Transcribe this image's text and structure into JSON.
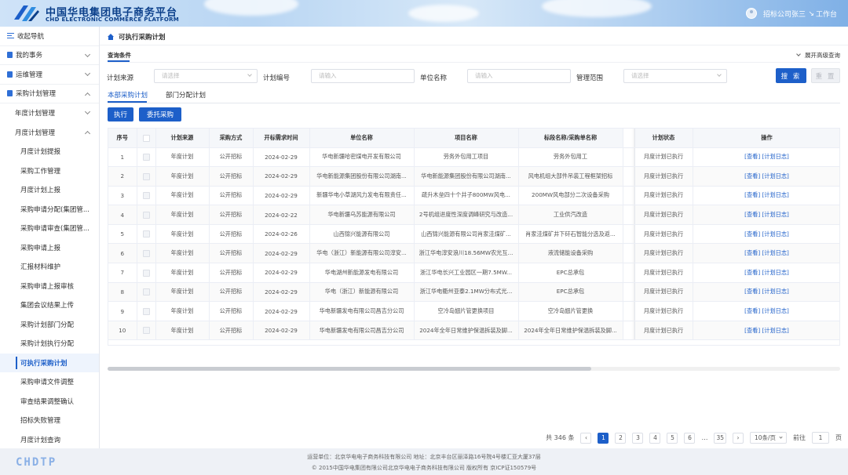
{
  "header": {
    "brand_cn": "中国华电集团电子商务平台",
    "brand_en": "CHD ELECTRONIC COMMERCE PLATFORM",
    "user_name": "招标公司张三",
    "workbench_label": "工作台"
  },
  "sidebar": {
    "collapse_label": "收起导航",
    "sections": [
      {
        "label": "我的事务",
        "expanded": false
      },
      {
        "label": "运维管理",
        "expanded": false
      },
      {
        "label": "采购计划管理",
        "expanded": true
      }
    ],
    "sub_groups": [
      {
        "label": "年度计划管理",
        "expanded": false
      },
      {
        "label": "月度计划管理",
        "expanded": true
      }
    ],
    "items": [
      "月度计划提报",
      "采购工作管理",
      "月度计划上报",
      "采购申请分配(集团管...",
      "采购申请审查(集团管...",
      "采购申请上报",
      "汇报材料维护",
      "采购申请上报审核",
      "集团会议结果上传",
      "采购计划部门分配",
      "采购计划执行分配",
      "可执行采购计划",
      "采购申请文件调整",
      "审查结果调整确认",
      "招标失败管理",
      "月度计划查询"
    ],
    "active_item": "可执行采购计划"
  },
  "breadcrumb": {
    "title": "可执行采购计划"
  },
  "query": {
    "title": "查询条件",
    "advanced_label": "展开高级查询",
    "fields": [
      {
        "label": "计划来源",
        "placeholder": "请选择",
        "type": "select"
      },
      {
        "label": "计划编号",
        "placeholder": "请输入",
        "type": "input"
      },
      {
        "label": "单位名称",
        "placeholder": "请输入",
        "type": "input"
      },
      {
        "label": "管理范围",
        "placeholder": "请选择",
        "type": "select"
      }
    ],
    "search_label": "搜 索",
    "reset_label": "重 置"
  },
  "tabs": [
    {
      "label": "本部采购计划",
      "active": true
    },
    {
      "label": "部门分配计划",
      "active": false
    }
  ],
  "actions": {
    "execute_label": "执行",
    "entrust_label": "委托采购"
  },
  "table": {
    "columns": [
      "序号",
      "",
      "计划来源",
      "采购方式",
      "开标需求时间",
      "单位名称",
      "项目名称",
      "标段名称/采购单名称",
      "",
      "计划状态",
      "操作"
    ],
    "action_view": "[查看]",
    "action_log": "[计划日志]",
    "rows": [
      {
        "no": "1",
        "source": "年度计划",
        "method": "公开招标",
        "date": "2024-02-29",
        "unit": "华电新疆哈密煤电开发有限公司",
        "project": "劳务外包用工项目",
        "section": "劳务外包用工",
        "status": "月度计划已执行"
      },
      {
        "no": "2",
        "source": "年度计划",
        "method": "公开招标",
        "date": "2024-02-29",
        "unit": "华电新能源集团股份有限公司湖南...",
        "project": "华电新能源集团股份有限公司湖南...",
        "section": "风电机组大部件吊装工程框架招标",
        "status": "月度计划已执行"
      },
      {
        "no": "3",
        "source": "年度计划",
        "method": "公开招标",
        "date": "2024-02-29",
        "unit": "新疆华电小草湖风力发电有限责任...",
        "project": "疏升木垒四十个井子800MW风电...",
        "section": "200MW风电部分二次设备采购",
        "status": "月度计划已执行"
      },
      {
        "no": "4",
        "source": "年度计划",
        "method": "公开招标",
        "date": "2024-02-22",
        "unit": "华电新疆乌苏能源有限公司",
        "project": "2号机组进度性深度调峰研究与改造...",
        "section": "工业供汽改造",
        "status": "月度计划已执行"
      },
      {
        "no": "5",
        "source": "年度计划",
        "method": "公开招标",
        "date": "2024-02-26",
        "unit": "山西锦兴能源有限公司",
        "project": "山西锦兴能源有限公司肖家洼煤矿...",
        "section": "肖家洼煤矿井下矸石智能分选及返...",
        "status": "月度计划已执行"
      },
      {
        "no": "6",
        "source": "年度计划",
        "method": "公开招标",
        "date": "2024-02-29",
        "unit": "华电（浙江）新能源有限公司淳安...",
        "project": "浙江华电淳安浪川18.56MW农光互...",
        "section": "液流储能设备采购",
        "status": "月度计划已执行"
      },
      {
        "no": "7",
        "source": "年度计划",
        "method": "公开招标",
        "date": "2024-02-29",
        "unit": "华电湖州新能源发电有限公司",
        "project": "浙江华电长兴工业园区一期7.5MW...",
        "section": "EPC总承包",
        "status": "月度计划已执行"
      },
      {
        "no": "8",
        "source": "年度计划",
        "method": "公开招标",
        "date": "2024-02-29",
        "unit": "华电（浙江）新能源有限公司",
        "project": "浙江华电衢州亚泰2.1MW分布式光...",
        "section": "EPC总承包",
        "status": "月度计划已执行"
      },
      {
        "no": "9",
        "source": "年度计划",
        "method": "公开招标",
        "date": "2024-02-29",
        "unit": "华电新疆发电有限公司昌吉分公司",
        "project": "空冷岛翅片管更换项目",
        "section": "空冷岛翅片管更换",
        "status": "月度计划已执行"
      },
      {
        "no": "10",
        "source": "年度计划",
        "method": "公开招标",
        "date": "2024-02-29",
        "unit": "华电新疆发电有限公司昌吉分公司",
        "project": "2024年全年日常维护保温拆装及脚...",
        "section": "2024年全年日常维护保温拆装及脚...",
        "status": "月度计划已执行"
      }
    ]
  },
  "pagination": {
    "total": "共 346 条",
    "pages": [
      "1",
      "2",
      "3",
      "4",
      "5",
      "6",
      "…",
      "35"
    ],
    "active_page": "1",
    "page_size": "10条/页",
    "goto_label": "前往",
    "goto_value": "1",
    "page_unit": "页"
  },
  "footer": {
    "logo": "CHDTP",
    "line1": "运营单位：北京华电电子商务科技有限公司   地址：北京丰台区丽泽路16号院4号楼汇亚大厦37层",
    "line2": "© 2015中国华电集团有限公司北京华电电子商务科技有限公司 版权所有 京ICP证150579号"
  },
  "colors": {
    "primary": "#1d5fc9",
    "header_text": "#0b3f8a"
  }
}
